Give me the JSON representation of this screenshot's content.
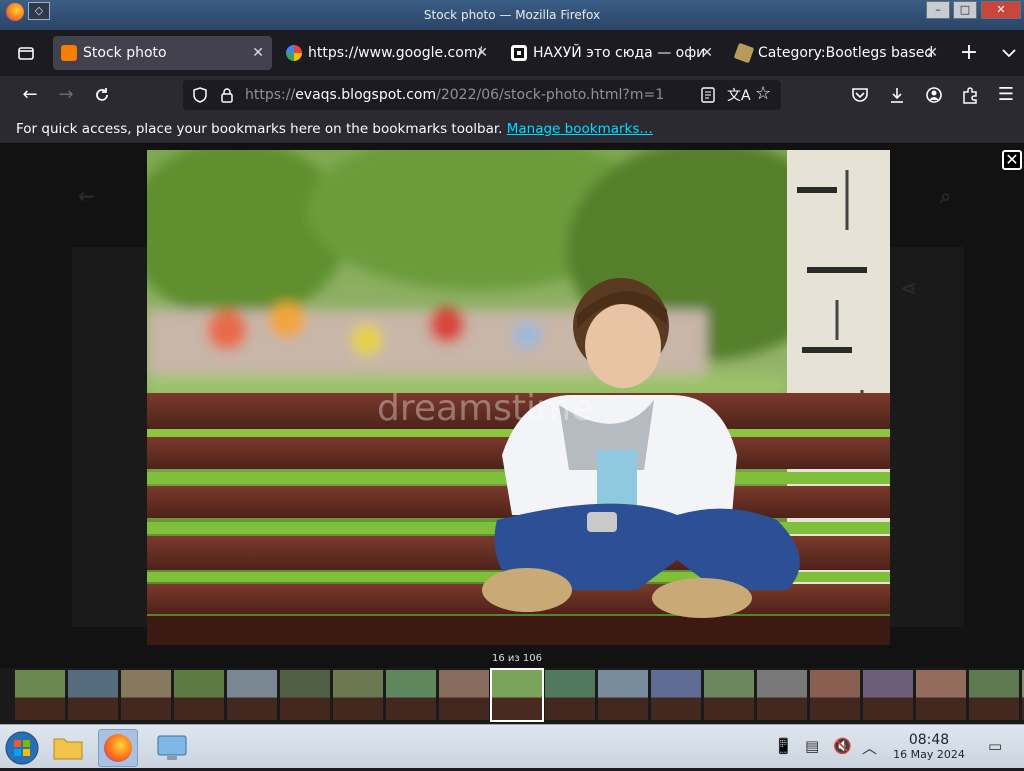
{
  "window": {
    "title": "Stock photo — Mozilla Firefox",
    "minimize_icon": "minimize-icon",
    "maximize_icon": "maximize-icon",
    "close_icon": "close-icon"
  },
  "tabs": [
    {
      "label": "Stock photo",
      "favicon": "blogger",
      "active": true
    },
    {
      "label": "https://www.google.com/",
      "favicon": "google",
      "active": false
    },
    {
      "label": "НАХУЙ это сюда — офи",
      "favicon": "site",
      "active": false
    },
    {
      "label": "Category:Bootlegs based",
      "favicon": "wiki",
      "active": false
    }
  ],
  "navbar": {
    "url_base": "https://",
    "url_host": "evaqs.blogspot.com",
    "url_path": "/2022/06/stock-photo.html?m=1"
  },
  "bookmarks_bar": {
    "message": "For quick access, place your bookmarks here on the bookmarks toolbar.",
    "link": "Manage bookmarks…"
  },
  "lightbox": {
    "counter": "16 из 106",
    "watermark": "dreamstime",
    "thumbnail_count": 20,
    "active_thumbnail_index": 9
  },
  "taskbar": {
    "time": "08:48",
    "date": "16 May 2024"
  },
  "colors": {
    "accent_link": "#00ddff",
    "tab_active": "#42414d",
    "toolbar": "#2b2a33",
    "taskbar": "#d4dce6"
  }
}
